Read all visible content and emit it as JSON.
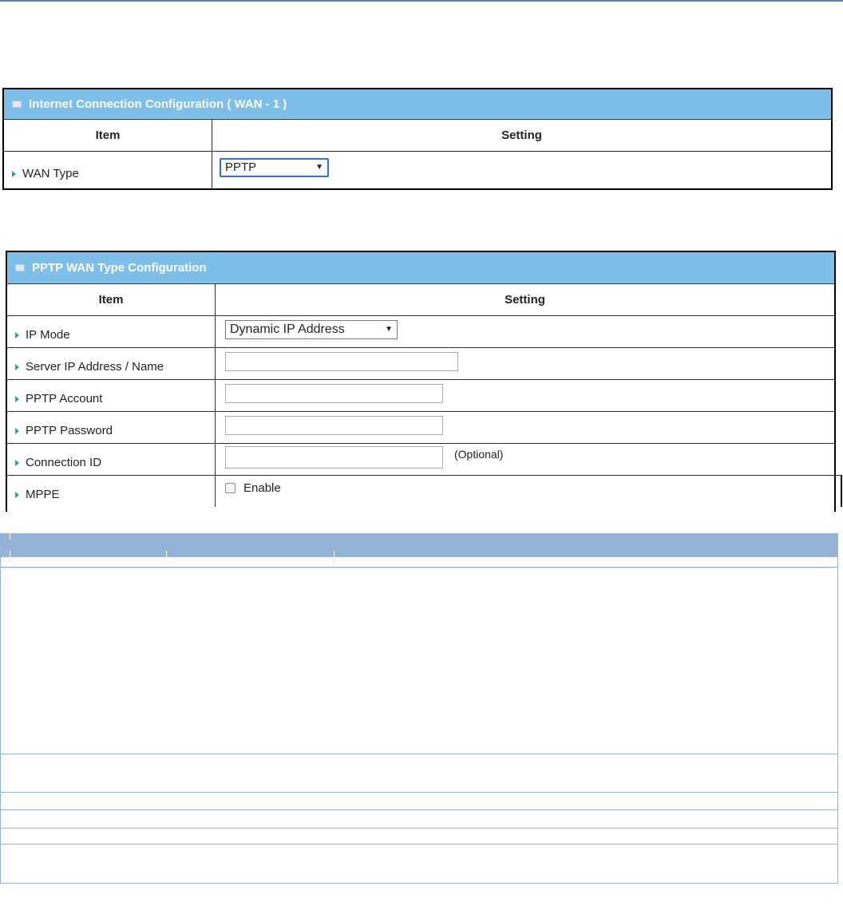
{
  "wan_panel": {
    "title": "Internet Connection Configuration ( WAN - 1 )",
    "header_item": "Item",
    "header_setting": "Setting",
    "rows": [
      {
        "label": "WAN Type",
        "value": "PPTP"
      }
    ]
  },
  "pptp_panel": {
    "title": "PPTP WAN Type Configuration",
    "header_item": "Item",
    "header_setting": "Setting",
    "ip_mode": {
      "label": "IP Mode",
      "value": "Dynamic IP Address"
    },
    "server": {
      "label": "Server IP Address / Name",
      "value": ""
    },
    "account": {
      "label": "PPTP Account",
      "value": ""
    },
    "password": {
      "label": "PPTP Password",
      "value": ""
    },
    "connection_id": {
      "label": "Connection ID",
      "value": "",
      "note": "(Optional)"
    },
    "mppe": {
      "label": "MPPE",
      "checkbox_label": "Enable",
      "checked": false
    }
  },
  "colors": {
    "panel_title_bg": "#7ebfea",
    "desc_header_bg": "#95b3d7",
    "row_arrow": "#27a3a8"
  }
}
